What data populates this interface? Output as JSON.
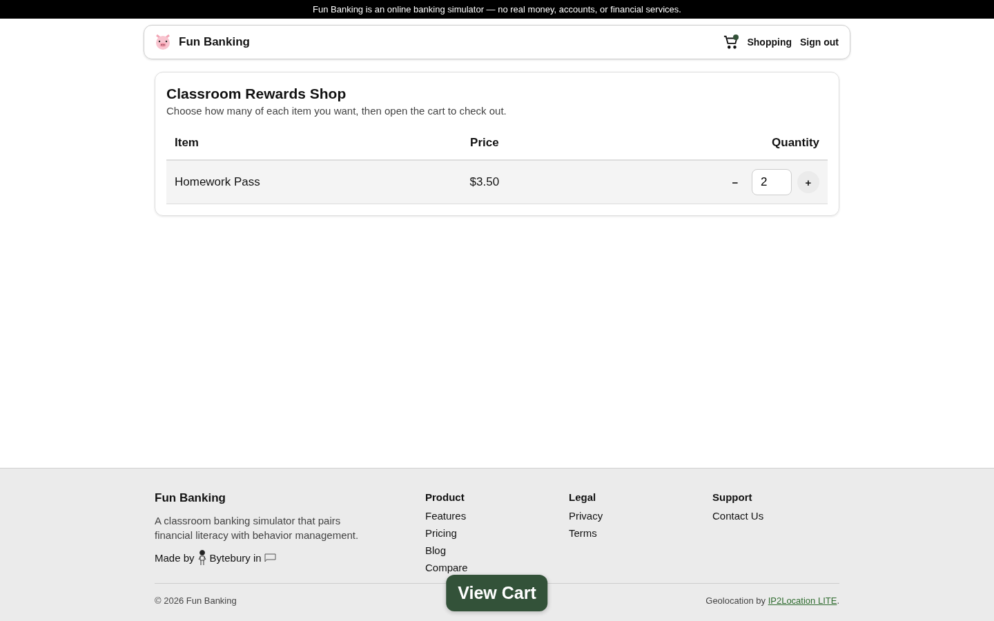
{
  "banner": "Fun Banking is an online banking simulator — no real money, accounts, or financial services.",
  "header": {
    "brand": "Fun Banking",
    "cart_has_items": true,
    "links": [
      "Shopping",
      "Sign out"
    ]
  },
  "shop": {
    "title": "Classroom Rewards Shop",
    "subtitle": "Choose how many of each item you want, then open the cart to check out.",
    "columns": [
      "Item",
      "Price",
      "Quantity"
    ],
    "rows": [
      {
        "item": "Homework Pass",
        "price": "$3.50",
        "decrement": "−",
        "quantity": "2",
        "increment": "+"
      }
    ]
  },
  "footer": {
    "brand": "Fun Banking",
    "description": "A classroom banking simulator that pairs financial literacy with behavior management.",
    "made_by": "Made by",
    "maker": "Bytebury in",
    "columns": [
      {
        "heading": "Product",
        "links": [
          "Features",
          "Pricing",
          "Blog",
          "Compare"
        ]
      },
      {
        "heading": "Legal",
        "links": [
          "Privacy",
          "Terms"
        ]
      },
      {
        "heading": "Support",
        "links": [
          "Contact Us"
        ]
      }
    ],
    "copyright": "© 2026 Fun Banking",
    "geo_text": "Geolocation by",
    "geo_link": "IP2Location LITE",
    "geo_end": "."
  },
  "view_cart": "View Cart"
}
